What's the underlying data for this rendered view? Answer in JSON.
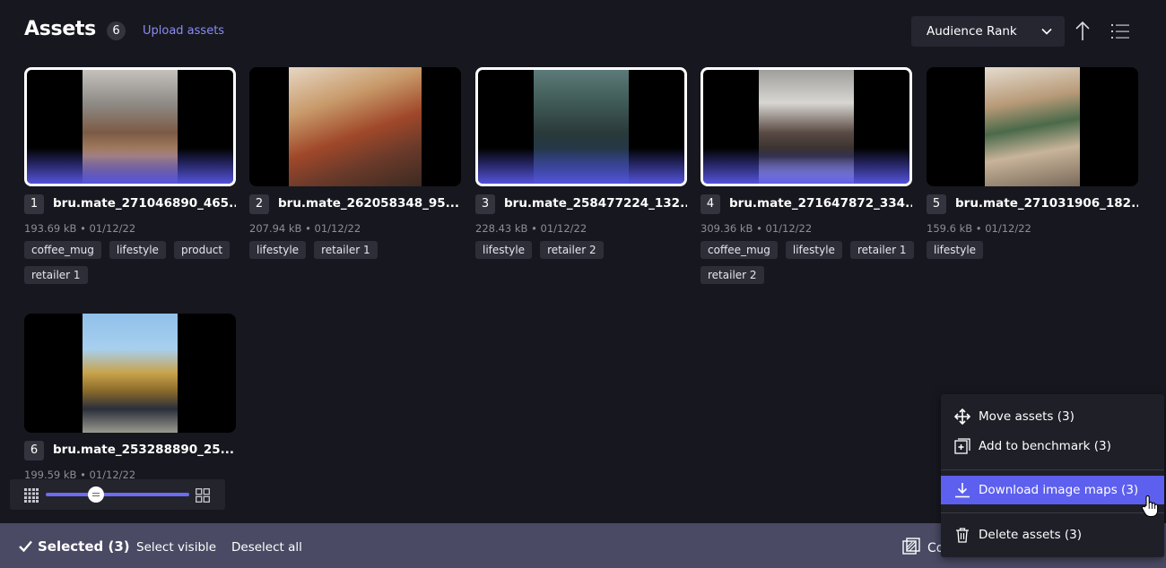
{
  "header": {
    "title": "Assets",
    "count": "6",
    "upload_label": "Upload assets",
    "sort_label": "Audience Rank"
  },
  "assets": [
    {
      "index": "1",
      "name": "bru.mate_271046890_465...",
      "meta": "193.69 kB • 01/12/22",
      "tags": [
        "coffee_mug",
        "lifestyle",
        "product",
        "retailer 1"
      ],
      "selected": true
    },
    {
      "index": "2",
      "name": "bru.mate_262058348_95...",
      "meta": "207.94 kB • 01/12/22",
      "tags": [
        "lifestyle",
        "retailer 1"
      ],
      "selected": false
    },
    {
      "index": "3",
      "name": "bru.mate_258477224_132...",
      "meta": "228.43 kB • 01/12/22",
      "tags": [
        "lifestyle",
        "retailer 2"
      ],
      "selected": true
    },
    {
      "index": "4",
      "name": "bru.mate_271647872_334...",
      "meta": "309.36 kB • 01/12/22",
      "tags": [
        "coffee_mug",
        "lifestyle",
        "retailer 1",
        "retailer 2"
      ],
      "selected": true
    },
    {
      "index": "5",
      "name": "bru.mate_271031906_182...",
      "meta": "159.6 kB • 01/12/22",
      "tags": [
        "lifestyle"
      ],
      "selected": false
    },
    {
      "index": "6",
      "name": "bru.mate_253288890_25...",
      "meta": "199.59 kB • 01/12/22",
      "tags": [],
      "selected": false
    }
  ],
  "zoom": {
    "level": 0.35
  },
  "bottombar": {
    "selected_label": "Selected (3)",
    "select_visible": "Select visible",
    "deselect_all": "Deselect all",
    "compare_label": "Co"
  },
  "menu": {
    "move": "Move assets (3)",
    "benchmark": "Add to benchmark (3)",
    "download": "Download image maps (3)",
    "delete": "Delete assets (3)"
  },
  "colors": {
    "accent": "#5d5fef",
    "background": "#17171f",
    "bottombar": "#4a4a64",
    "link": "#8a8cf5"
  }
}
